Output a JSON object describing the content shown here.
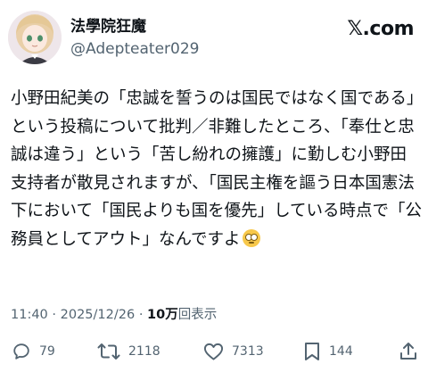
{
  "user": {
    "display_name": "法學院狂魔",
    "handle": "@Adepteater029"
  },
  "brand": {
    "logo_text": "𝕏.com"
  },
  "post": {
    "text": "小野田紀美の「忠誠を誓うのは国民ではなく国である」という投稿について批判／非難したところ、「奉仕と忠誠は違う」という「苦し紛れの擁護」に勤しむ小野田支持者が散見されますが、「国民主権を謳う日本国憲法下において「国民よりも国を優先」している時点で「公務員としてアウト」なんですよ",
    "emoji": "rolling-eyes",
    "time": "11:40",
    "separator": "·",
    "date": "2025/12/26",
    "views_count": "10万",
    "views_label": "回表示"
  },
  "actions": {
    "reply_count": "79",
    "repost_count": "2118",
    "like_count": "7313",
    "bookmark_count": "144"
  },
  "colors": {
    "text": "#0f1419",
    "secondary": "#536471",
    "background": "#ffffff"
  }
}
